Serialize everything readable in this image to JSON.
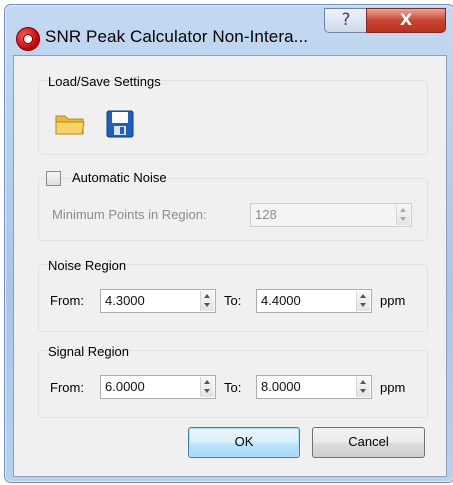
{
  "window": {
    "title": "SNR Peak Calculator Non-Intera...",
    "help_label": "?",
    "close_label": "X"
  },
  "load_save": {
    "title": "Load/Save Settings",
    "open_icon": "folder-open-icon",
    "save_icon": "floppy-disk-save-icon"
  },
  "noise": {
    "automatic_label": "Automatic Noise",
    "automatic_checked": false,
    "min_points_label": "Minimum Points in Region:",
    "min_points_value": "128"
  },
  "noise_region": {
    "title": "Noise Region",
    "from_label": "From:",
    "from_value": "4.3000",
    "to_label": "To:",
    "to_value": "4.4000",
    "unit": "ppm"
  },
  "signal_region": {
    "title": "Signal Region",
    "from_label": "From:",
    "from_value": "6.0000",
    "to_label": "To:",
    "to_value": "8.0000",
    "unit": "ppm"
  },
  "buttons": {
    "ok": "OK",
    "cancel": "Cancel"
  },
  "colors": {
    "title_bar": "#b7d0ee",
    "close_button": "#c9452f",
    "save_icon": "#1f5fbf",
    "folder_icon": "#e7b633"
  }
}
